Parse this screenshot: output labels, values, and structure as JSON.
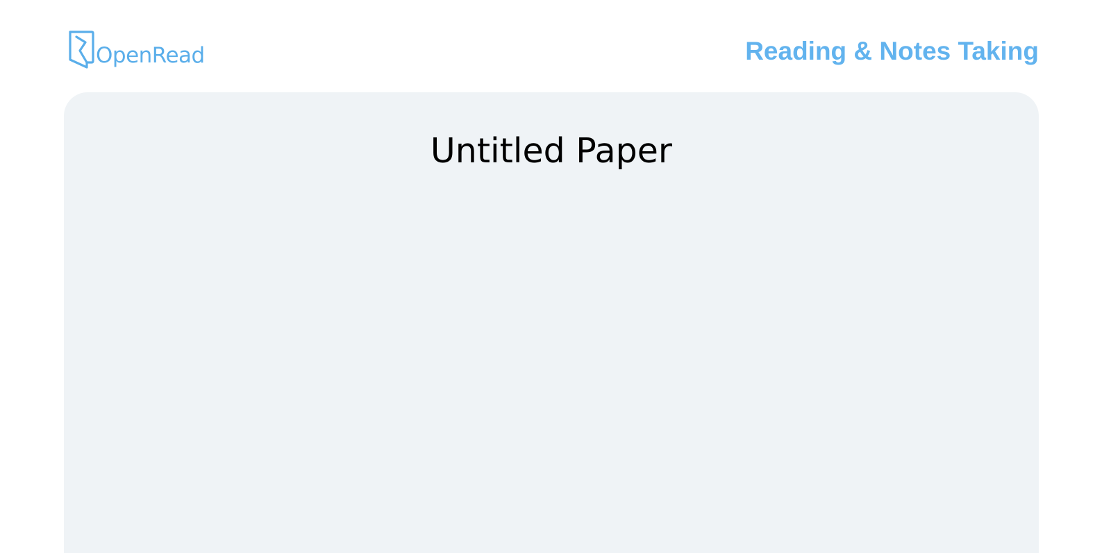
{
  "header": {
    "brand": {
      "icon": "openread-logo-icon",
      "name": "OpenRead"
    },
    "tagline": "Reading & Notes Taking"
  },
  "paper": {
    "title": "Untitled Paper"
  },
  "colors": {
    "brand": "#5aaeea",
    "tagline": "#62b3ee",
    "panel_background": "#eff3f6",
    "title_text": "#000000"
  }
}
